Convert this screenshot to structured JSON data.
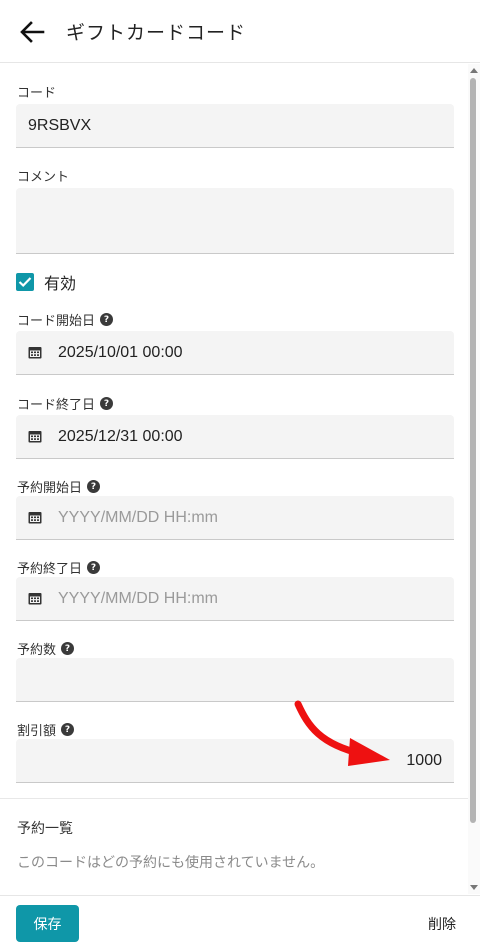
{
  "header": {
    "title": "ギフトカードコード"
  },
  "form": {
    "code": {
      "label": "コード",
      "value": "9RSBVX"
    },
    "comment": {
      "label": "コメント",
      "value": ""
    },
    "enabled": {
      "label": "有効",
      "checked": true
    },
    "code_start": {
      "label": "コード開始日",
      "value": "2025/10/01 00:00"
    },
    "code_end": {
      "label": "コード終了日",
      "value": "2025/12/31 00:00"
    },
    "reservation_start": {
      "label": "予約開始日",
      "placeholder": "YYYY/MM/DD HH:mm"
    },
    "reservation_end": {
      "label": "予約終了日",
      "placeholder": "YYYY/MM/DD HH:mm"
    },
    "reservation_count": {
      "label": "予約数",
      "value": ""
    },
    "discount": {
      "label": "割引額",
      "value": "1000"
    }
  },
  "reservations": {
    "title": "予約一覧",
    "empty_text": "このコードはどの予約にも使用されていません。"
  },
  "footer": {
    "save_label": "保存",
    "delete_label": "削除"
  },
  "colors": {
    "accent": "#0f97a8",
    "annotation_arrow": "#ee1111"
  },
  "icons": {
    "back": "arrow-left-icon",
    "calendar": "calendar-icon",
    "help": "question-circle-icon"
  }
}
